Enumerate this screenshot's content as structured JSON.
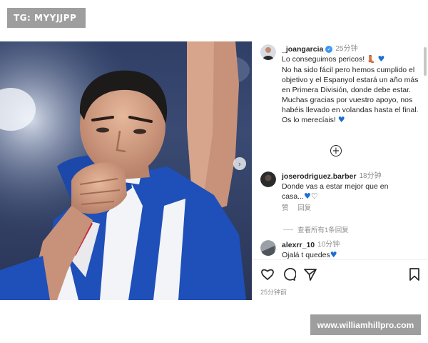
{
  "watermark_top": "TG: MYYJJPP",
  "watermark_bottom": "www.williamhillpro.com",
  "post": {
    "author": {
      "username": "_joangarcia",
      "verified": true,
      "time": "25分钟",
      "caption_line1": "Lo conseguimos pericos! ",
      "caption_rest": "No ha sido fácil pero hemos cumplido el objetivo y el Espanyol estará un año más en Primera División, donde debe estar. Muchas gracias por vuestro apoyo, nos habéis llevado en volandas hasta el final. Os lo merecíais! "
    },
    "load_more_icon": "plus-circle-icon",
    "comments": [
      {
        "username": "joserodriguez.barber",
        "time": "18分钟",
        "text": "Donde vas a estar mejor que en casa...",
        "reply_label": "赞",
        "reply_action": "回复",
        "view_replies": "查看所有1条回复"
      },
      {
        "username": "alexrr_10",
        "time": "10分钟",
        "text": "Ojalá t quedes"
      }
    ],
    "footer": {
      "icons": [
        "heart-icon",
        "comment-icon",
        "share-icon",
        "bookmark-icon"
      ],
      "post_time": "25分钟前"
    }
  },
  "colors": {
    "heart_blue": "#1c6fd1",
    "jersey_blue": "#1f4fb8",
    "muted_text": "#8e8e8e"
  }
}
